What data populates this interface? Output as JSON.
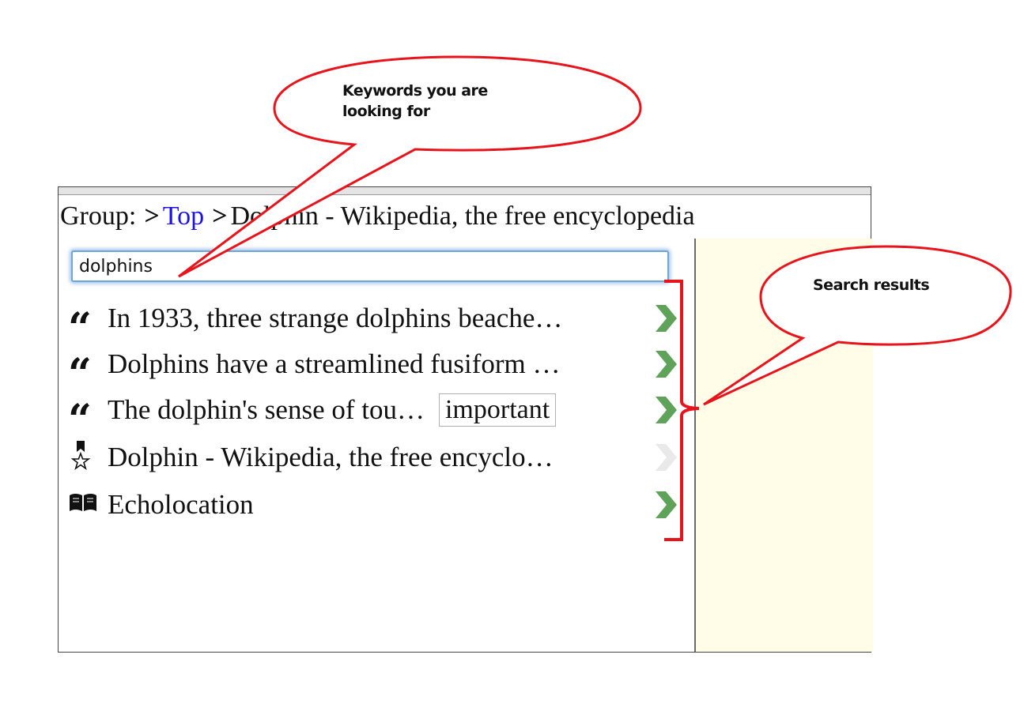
{
  "breadcrumb": {
    "label": "Group:",
    "sep1": ">",
    "top_link": "Top",
    "sep2": ">",
    "current": "Dolphin - Wikipedia, the free encyclopedia"
  },
  "search": {
    "value": "dolphins"
  },
  "results": [
    {
      "icon": "quote-icon",
      "text": "In 1933, three strange dolphins beache…",
      "tag": "",
      "chevron": "active"
    },
    {
      "icon": "quote-icon",
      "text": "Dolphins have a streamlined fusiform …",
      "tag": "",
      "chevron": "active"
    },
    {
      "icon": "quote-icon",
      "text": "The dolphin's sense of tou…",
      "tag": "important",
      "chevron": "active"
    },
    {
      "icon": "bookmark-star-icon",
      "text": "Dolphin - Wikipedia, the free encyclo…",
      "tag": "",
      "chevron": "disabled"
    },
    {
      "icon": "book-icon",
      "text": "Echolocation",
      "tag": "",
      "chevron": "active"
    }
  ],
  "annotations": {
    "keywords_callout": "Keywords you are looking for",
    "keywords_line1": "Keywords you are",
    "keywords_line2": "looking for",
    "results_callout": "Search results"
  },
  "colors": {
    "link": "#1a12e6",
    "chevron_active": "#5fa35a",
    "chevron_disabled": "#e9e9e9",
    "callout_stroke": "#e8141c",
    "side_panel": "#fffde8",
    "input_focus": "#6ea6d8"
  }
}
